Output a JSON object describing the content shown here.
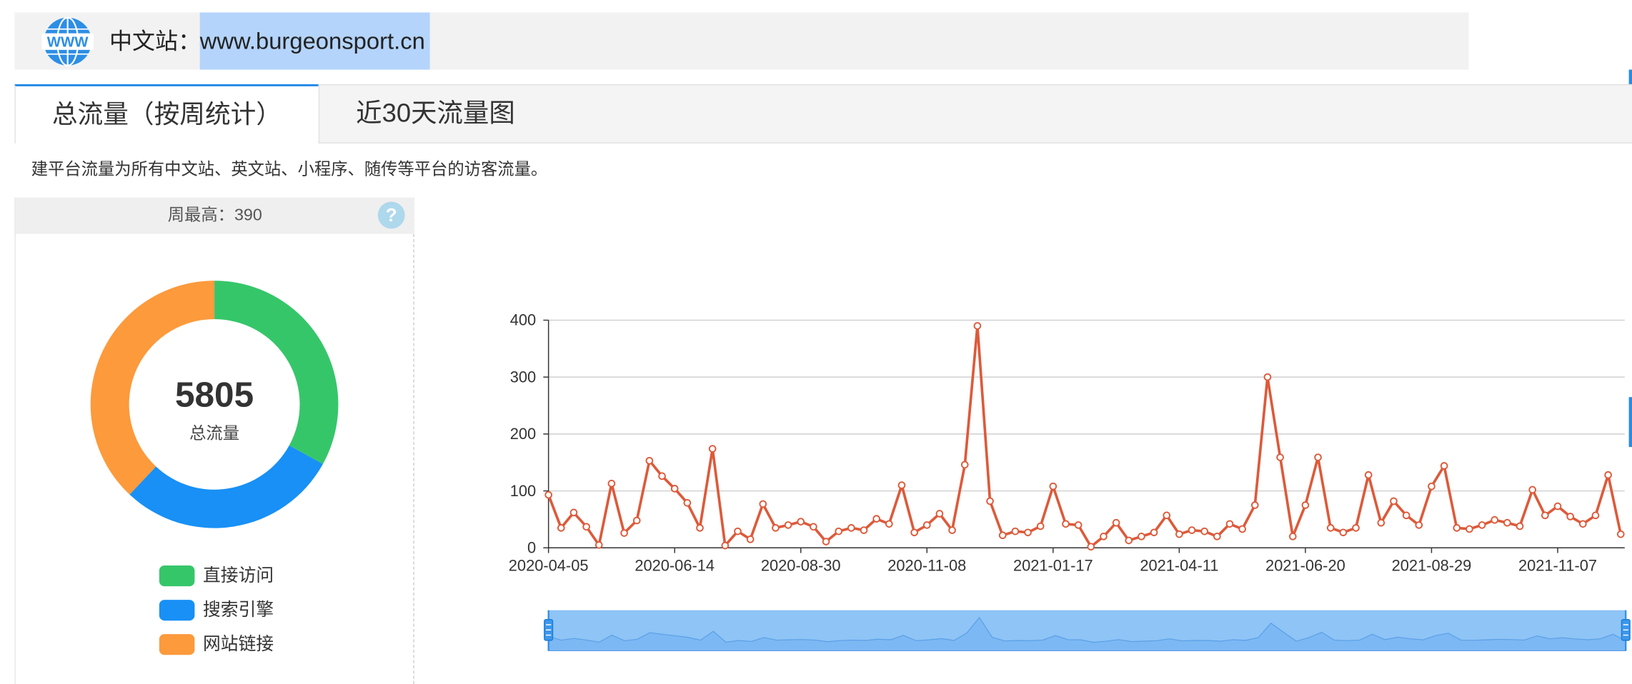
{
  "header": {
    "globe_icon": "globe-www-icon",
    "globe_text": "WWW",
    "site_label": "中文站：",
    "site_url": "www.burgeonsport.cn"
  },
  "tabs": [
    {
      "label": "总流量（按周统计）",
      "active": true
    },
    {
      "label": "近30天流量图",
      "active": false
    }
  ],
  "description": "建平台流量为所有中文站、英文站、小程序、随传等平台的访客流量。",
  "summary": {
    "weekly_max_label": "周最高：",
    "weekly_max_value": "390",
    "help_icon": "question-circle-icon",
    "help_glyph": "?"
  },
  "colors": {
    "accent": "#2189e5",
    "selection": "#b4d4fb",
    "line": "#dd5a3a"
  },
  "chart_data": [
    {
      "type": "line",
      "x_tick_labels": [
        "2020-04-05",
        "2020-06-14",
        "2020-08-30",
        "2020-11-08",
        "2021-01-17",
        "2021-04-11",
        "2021-06-20",
        "2021-08-29",
        "2021-11-07"
      ],
      "x_tick_every": 10,
      "series": [
        {
          "values": [
            93,
            35,
            62,
            37,
            5,
            113,
            26,
            48,
            153,
            126,
            104,
            79,
            35,
            174,
            4,
            29,
            15,
            77,
            35,
            40,
            46,
            37,
            11,
            29,
            35,
            31,
            51,
            42,
            110,
            27,
            40,
            60,
            31,
            146,
            390,
            82,
            22,
            29,
            27,
            38,
            108,
            42,
            40,
            2,
            20,
            44,
            13,
            20,
            27,
            57,
            24,
            31,
            29,
            20,
            42,
            33,
            75,
            300,
            159,
            20,
            75,
            159,
            35,
            27,
            35,
            128,
            44,
            82,
            57,
            40,
            108,
            144,
            35,
            33,
            40,
            49,
            44,
            38,
            102,
            57,
            73,
            55,
            42,
            57,
            128,
            24
          ]
        }
      ],
      "ylim": [
        0,
        400
      ],
      "y_ticks": [
        0,
        100,
        200,
        300,
        400
      ],
      "grid": "horizontal",
      "color": "#dd5a3a",
      "data_zoom": {
        "start_percent": 0,
        "end_percent": 100
      }
    },
    {
      "type": "pie",
      "categories": [
        "直接访问",
        "搜索引擎",
        "网站链接"
      ],
      "shares_percent": [
        33,
        29,
        38
      ],
      "colors": [
        "#36c66a",
        "#1890f5",
        "#fc9a3c"
      ],
      "center_text": "5805",
      "center_subtext": "总流量"
    }
  ]
}
